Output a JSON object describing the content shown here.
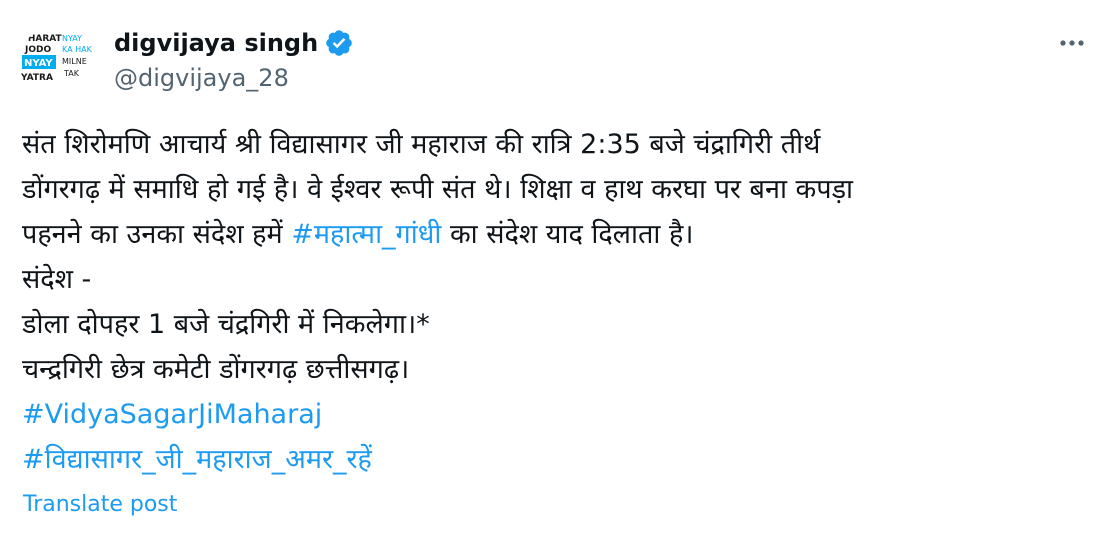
{
  "author": {
    "display_name": "digvijaya singh",
    "handle": "@digvijaya_28",
    "avatar_text": [
      "BHARAT",
      "JODO",
      "NYAY",
      "YATRA",
      "NYAY",
      "KA HAK",
      "MILNE",
      "TAK"
    ],
    "verified_icon": "verified-badge-icon"
  },
  "more_icon": "more-options-icon",
  "post": {
    "line1": "संत शिरोमणि आचार्य श्री विद्यासागर जी महाराज की रात्रि 2:35 बजे चंद्रागिरी तीर्थ",
    "line2": "डोंगरगढ़  में समाधि हो गई है। वे ईश्वर रूपी संत थे। शिक्षा व हाथ करघा पर बना कपड़ा",
    "line3_before": "पहनने का उनका संदेश हमें ",
    "line3_hashtag": "#महात्मा_गांधी",
    "line3_after": " का संदेश याद दिलाता है।",
    "line4": "संदेश -",
    "line5": "डोला दोपहर 1 बजे चंद्रगिरी में  निकलेगा।*",
    "line6": "चन्द्रगिरी छेत्र कमेटी डोंगरगढ़ छत्तीसगढ़।",
    "hashtag1": "#VidyaSagarJiMaharaj",
    "hashtag2": "#विद्यासागर_जी_महाराज_अमर_रहें"
  },
  "translate_label": "Translate post",
  "colors": {
    "link": "#1d9bf0",
    "text": "#0f1419",
    "secondary": "#536471",
    "avatar_blue": "#00aeef",
    "avatar_dark": "#1a1a1a"
  }
}
